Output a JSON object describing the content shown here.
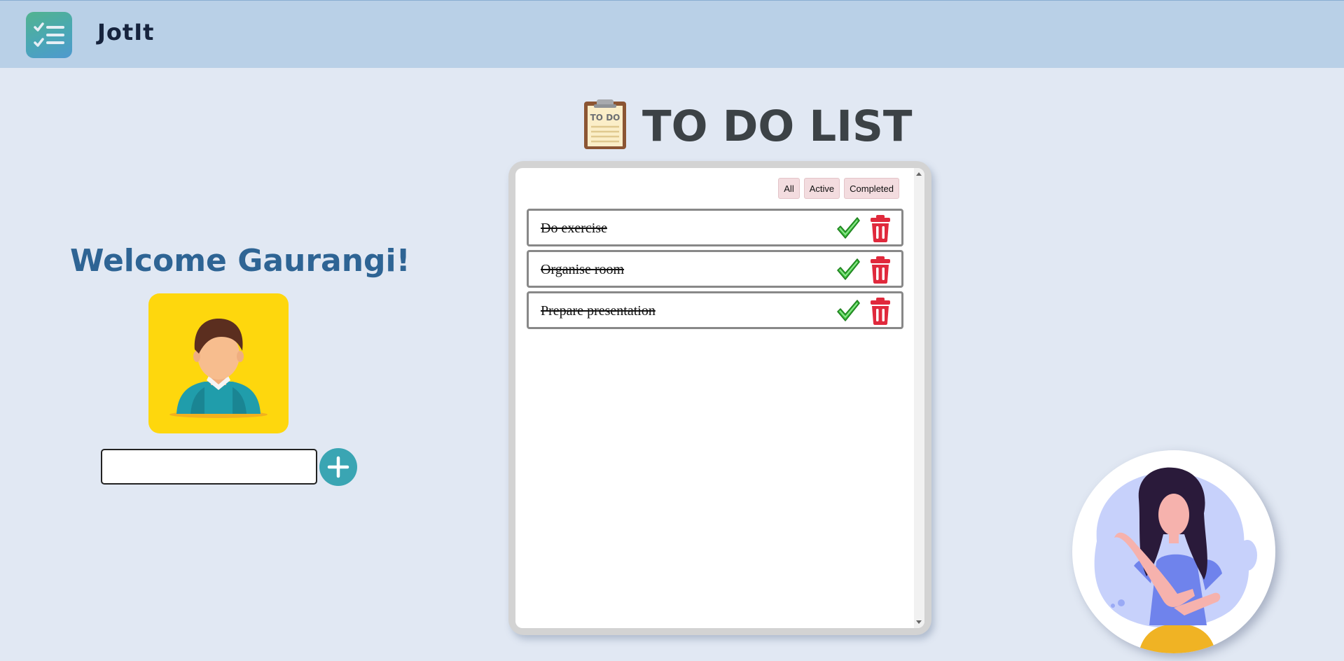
{
  "app": {
    "brand": "JotIt",
    "logo_icon": "checklist-icon"
  },
  "user": {
    "welcome": "Welcome Gaurangi!",
    "avatar_icon": "user-avatar-icon"
  },
  "new_task": {
    "value": "",
    "placeholder": "",
    "add_icon": "plus-icon"
  },
  "todo": {
    "title": "TO DO LIST",
    "title_icon": "clipboard-icon",
    "filters": {
      "all": "All",
      "active": "Active",
      "completed": "Completed"
    },
    "items": [
      {
        "text": "Do exercise",
        "completed": true
      },
      {
        "text": "Organise room",
        "completed": true
      },
      {
        "text": "Prepare presentation",
        "completed": true
      }
    ]
  },
  "colors": {
    "header_bg": "#b9d0e7",
    "page_bg": "#e1e8f3",
    "welcome_text": "#2e6494",
    "add_button": "#3aa5b3",
    "filter_bg": "#f3dcdf",
    "check_green": "#3cc23c",
    "delete_red": "#e0293c"
  }
}
